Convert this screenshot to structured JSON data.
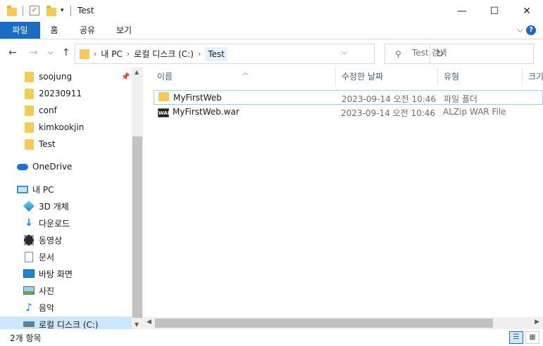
{
  "window": {
    "title": "Test",
    "minimize_glyph": "—",
    "maximize_glyph": "☐",
    "close_glyph": "✕"
  },
  "ribbon": {
    "tabs": [
      "파일",
      "홈",
      "공유",
      "보기"
    ],
    "collapse_glyph": "⌵",
    "help_glyph": "?"
  },
  "nav": {
    "back_glyph": "←",
    "forward_glyph": "→",
    "recent_glyph": "⌵",
    "up_glyph": "↑"
  },
  "address": {
    "crumbs": [
      "내 PC",
      "로컬 디스크 (C:)",
      "Test"
    ],
    "refresh_glyph": "↻"
  },
  "search": {
    "placeholder": "Test 검색"
  },
  "sidebar": {
    "quick_access": [
      "soojung",
      "20230911",
      "conf",
      "kimkookjin",
      "Test"
    ],
    "onedrive": "OneDrive",
    "this_pc": "내 PC",
    "pc_items": [
      "3D 개체",
      "다운로드",
      "동영상",
      "문서",
      "바탕 화면",
      "사진",
      "음악",
      "로컬 디스크 (C:)"
    ]
  },
  "columns": {
    "name": "이름",
    "modified": "수정한 날짜",
    "type": "유형",
    "size": "크기"
  },
  "files": [
    {
      "name": "MyFirstWeb",
      "modified": "2023-09-14 오전 10:46",
      "type": "파일 폴더",
      "icon": "folder-icon"
    },
    {
      "name": "MyFirstWeb.war",
      "modified": "2023-09-14 오전 10:46",
      "type": "ALZip WAR File",
      "icon": "war-file-icon"
    }
  ],
  "status": {
    "item_count": "2개 항목"
  },
  "colors": {
    "accent": "#1a6dc2",
    "selection": "#cce8ff",
    "folder": "#f6cb55"
  }
}
